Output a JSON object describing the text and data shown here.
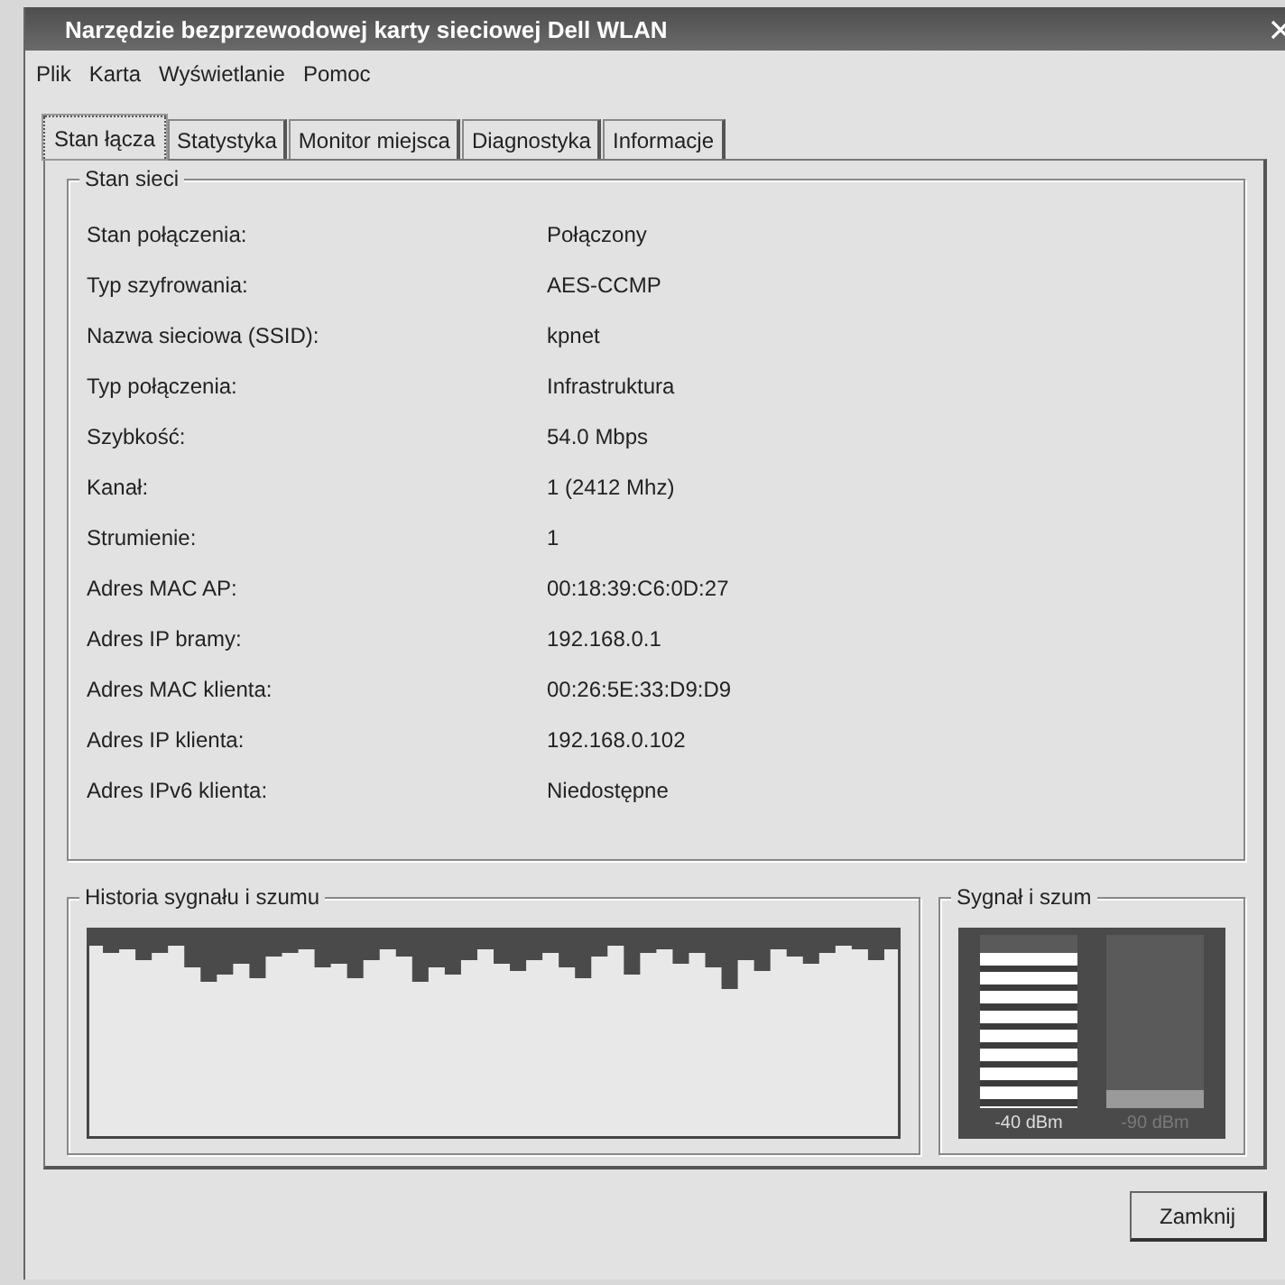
{
  "window": {
    "title": "Narzędzie bezprzewodowej karty sieciowej Dell WLAN"
  },
  "menu": [
    "Plik",
    "Karta",
    "Wyświetlanie",
    "Pomoc"
  ],
  "tabs": [
    {
      "label": "Stan łącza",
      "selected": true
    },
    {
      "label": "Statystyka",
      "selected": false
    },
    {
      "label": "Monitor miejsca",
      "selected": false
    },
    {
      "label": "Diagnostyka",
      "selected": false
    },
    {
      "label": "Informacje",
      "selected": false
    }
  ],
  "network_status": {
    "title": "Stan sieci",
    "rows": [
      {
        "label": "Stan połączenia:",
        "value": "Połączony"
      },
      {
        "label": "Typ szyfrowania:",
        "value": "AES-CCMP"
      },
      {
        "label": "Nazwa sieciowa (SSID):",
        "value": "kpnet"
      },
      {
        "label": "Typ połączenia:",
        "value": "Infrastruktura"
      },
      {
        "label": "Szybkość:",
        "value": "54.0 Mbps"
      },
      {
        "label": "Kanał:",
        "value": "1 (2412 Mhz)"
      },
      {
        "label": "Strumienie:",
        "value": "1"
      },
      {
        "label": "Adres MAC AP:",
        "value": "00:18:39:C6:0D:27"
      },
      {
        "label": "Adres IP bramy:",
        "value": "192.168.0.1"
      },
      {
        "label": "Adres MAC klienta:",
        "value": "00:26:5E:33:D9:D9"
      },
      {
        "label": "Adres IP klienta:",
        "value": "192.168.0.102"
      },
      {
        "label": "Adres IPv6 klienta:",
        "value": "Niedostępne"
      }
    ]
  },
  "history": {
    "title": "Historia sygnału i szumu"
  },
  "signal_noise": {
    "title": "Sygnał i szum",
    "meters": [
      {
        "kind": "signal",
        "level": 0.9,
        "reading": "-40 dBm"
      },
      {
        "kind": "noise",
        "level": 0.1,
        "reading": "-90 dBm"
      }
    ]
  },
  "buttons": [
    "Zamknij"
  ]
}
